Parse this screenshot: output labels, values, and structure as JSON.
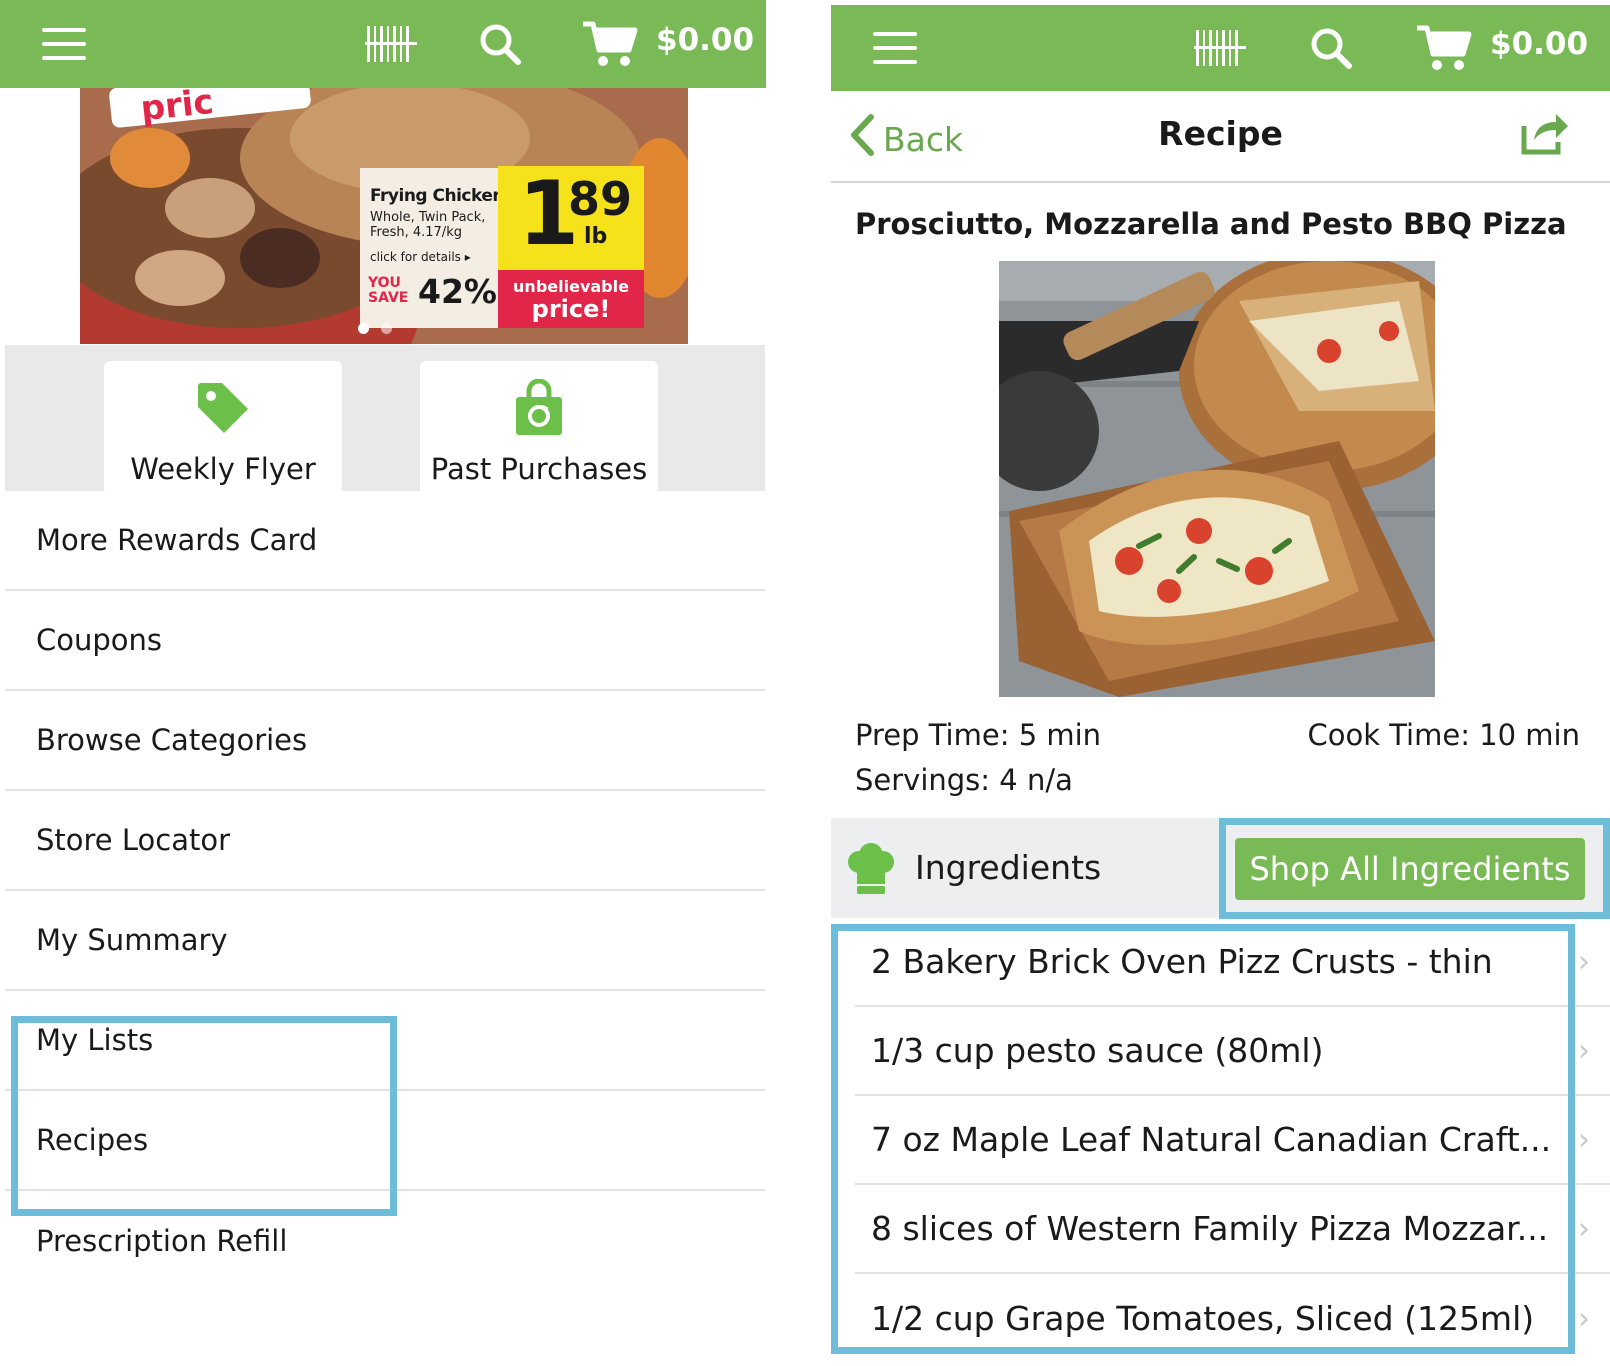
{
  "left": {
    "topbar": {
      "cart_total": "$0.00",
      "icons": [
        "menu-icon",
        "barcode-icon",
        "search-icon",
        "cart-icon"
      ]
    },
    "hero": {
      "product": "Frying Chicken",
      "desc_line1": "Whole, Twin Pack,",
      "desc_line2": "Fresh, 4.17/kg",
      "details_link": "click for details ▸",
      "you": "YOU",
      "save": "SAVE",
      "save_pct": "42%",
      "price_whole": "1",
      "price_cents": "89",
      "price_unit": "lb",
      "tag_line1": "unbelievable",
      "tag_line2": "price!"
    },
    "tiles": [
      {
        "label": "Weekly Flyer",
        "icon": "tag-icon"
      },
      {
        "label": "Past Purchases",
        "icon": "shopping-bag-icon"
      }
    ],
    "menu": [
      "More Rewards Card",
      "Coupons",
      "Browse Categories",
      "Store Locator",
      "My Summary",
      "My Lists",
      "Recipes",
      "Prescription Refill"
    ]
  },
  "right": {
    "topbar": {
      "cart_total": "$0.00"
    },
    "nav": {
      "back": "Back",
      "title": "Recipe"
    },
    "recipe": {
      "title": "Prosciutto, Mozzarella and Pesto BBQ Pizza",
      "prep": "Prep Time: 5 min",
      "cook": "Cook Time: 10 min",
      "servings": "Servings: 4 n/a"
    },
    "ingredients_label": "Ingredients",
    "shop_all": "Shop All Ingredients",
    "ingredients": [
      "2 Bakery Brick Oven Pizz Crusts - thin",
      "1/3 cup pesto sauce (80ml)",
      "7 oz Maple Leaf Natural Canadian Craft...",
      "8 slices of Western Family Pizza Mozzar...",
      "1/2 cup Grape Tomatoes, Sliced (125ml)"
    ]
  },
  "colors": {
    "brand_green": "#7aba56",
    "highlight_blue": "#6dbcd9",
    "link_green": "#6aa84f"
  }
}
